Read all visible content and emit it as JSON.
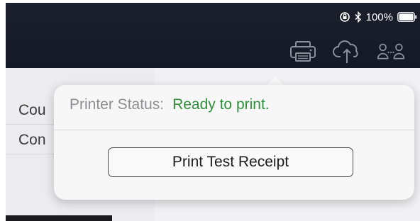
{
  "status_bar": {
    "orientation_lock_icon": "orientation-lock-icon",
    "bluetooth_icon": "bluetooth-icon",
    "battery_percent": "100%",
    "battery_level": 1.0
  },
  "toolbar": {
    "icons": [
      "printer-icon",
      "cloud-upload-icon",
      "users-icon"
    ]
  },
  "left_panel": {
    "items": [
      {
        "label": "Cou"
      },
      {
        "label": "Con"
      }
    ]
  },
  "popover": {
    "status_label": "Printer Status:",
    "status_value": "Ready to print.",
    "button_label": "Print Test Receipt"
  },
  "colors": {
    "status_ready": "#2f8f3a",
    "top_bar": "#161b27"
  }
}
